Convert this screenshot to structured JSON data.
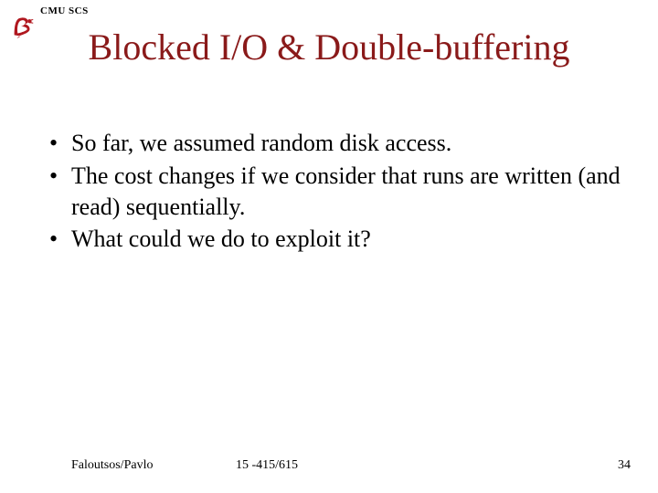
{
  "header": {
    "label": "CMU SCS"
  },
  "title": "Blocked I/O & Double-buffering",
  "bullets": [
    "So far, we assumed random disk access.",
    "The cost changes if we consider that runs are written (and read) sequentially.",
    "What could we do to exploit it?"
  ],
  "footer": {
    "left": "Faloutsos/Pavlo",
    "center": "15 -415/615",
    "right": "34"
  },
  "colors": {
    "title": "#8a1a1a",
    "logo": "#b0171f"
  }
}
